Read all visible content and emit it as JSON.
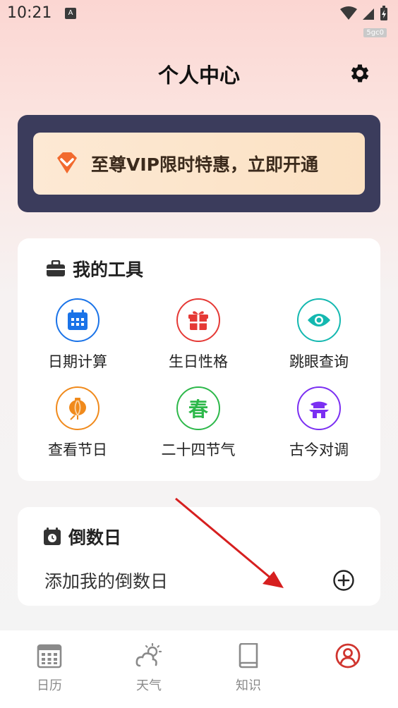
{
  "status_bar": {
    "time": "10:21",
    "notification_letter": "A",
    "tag": "5gc0"
  },
  "header": {
    "title": "个人中心"
  },
  "vip": {
    "text": "至尊VIP限时特惠，立即开通"
  },
  "tools": {
    "title": "我的工具",
    "items": [
      {
        "label": "日期计算",
        "icon": "calendar-icon",
        "color": "#1a73e8"
      },
      {
        "label": "生日性格",
        "icon": "gift-icon",
        "color": "#e53935"
      },
      {
        "label": "跳眼查询",
        "icon": "eye-icon",
        "color": "#14b8b0"
      },
      {
        "label": "查看节日",
        "icon": "lantern-icon",
        "color": "#f08a1c"
      },
      {
        "label": "二十四节气",
        "icon": "spring-char-icon",
        "color": "#2db84a",
        "glyph": "春"
      },
      {
        "label": "古今对调",
        "icon": "pavilion-icon",
        "color": "#7b2ff2"
      }
    ]
  },
  "countdown": {
    "title": "倒数日",
    "add_label": "添加我的倒数日"
  },
  "tabbar": {
    "tabs": [
      {
        "label": "日历",
        "icon": "calendar-grid-icon"
      },
      {
        "label": "天气",
        "icon": "weather-icon"
      },
      {
        "label": "知识",
        "icon": "book-icon"
      },
      {
        "label": "",
        "icon": "user-profile-icon",
        "active": true
      }
    ]
  },
  "colors": {
    "accent_red": "#d0352f",
    "vip_card_bg": "#3b3c5c",
    "annotation_arrow": "#d61f1f"
  }
}
